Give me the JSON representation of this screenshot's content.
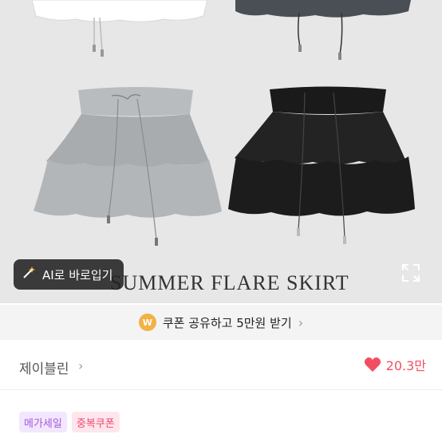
{
  "hero": {
    "title": "SUMMER FLARE SKIRT",
    "ai_button_label": "AI로 바로입기",
    "wand_icon": "magic-wand-icon",
    "expand_icon": "expand-icon"
  },
  "coupon": {
    "badge_letter": "W",
    "text": "쿠폰 공유하고 5만원 받기",
    "chevron": "›"
  },
  "seller": {
    "name": "제이블린",
    "chevron": "›",
    "likes": "20.3만",
    "heart_icon": "heart-icon"
  },
  "badges": [
    "메가세일",
    "중복쿠폰"
  ],
  "colors": {
    "heart": "#f24e63",
    "coupon_badge": "#f2b246",
    "badge_purple": "#a45ad9",
    "badge_pink": "#ee4870"
  }
}
